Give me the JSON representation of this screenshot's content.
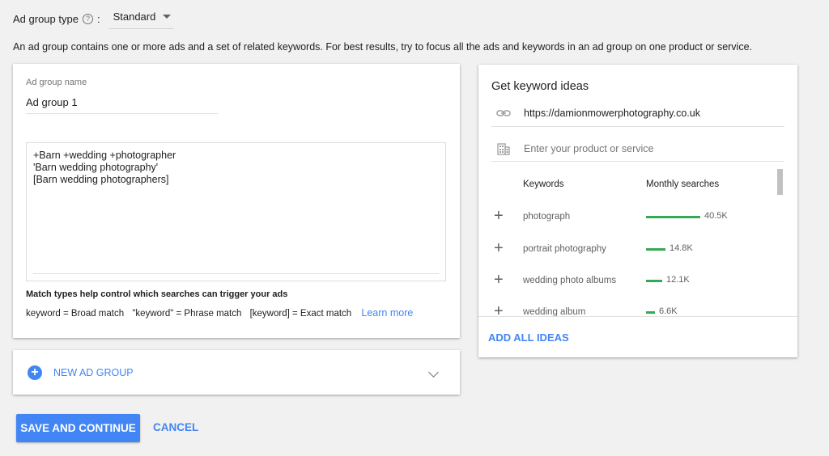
{
  "ad_group_type": {
    "label": "Ad group type",
    "help_icon": "?",
    "colon": ":",
    "selected": "Standard"
  },
  "description": "An ad group contains one or more ads and a set of related keywords. For best results, try to focus all the ads and keywords in an ad group on one product or service.",
  "ad_group": {
    "name_label": "Ad group name",
    "name_value": "Ad group 1",
    "keywords": [
      "+Barn +wedding +photographer",
      "'Barn wedding photography'",
      "[Barn wedding photographers]"
    ],
    "match_title": "Match types help control which searches can trigger your ads",
    "match_broad": "keyword = Broad match",
    "match_phrase": "\"keyword\" = Phrase match",
    "match_exact": "[keyword] = Exact match",
    "learn_more": "Learn more"
  },
  "new_ad_group": {
    "plus_glyph": "+",
    "label": "NEW AD GROUP"
  },
  "actions": {
    "save": "SAVE AND CONTINUE",
    "cancel": "CANCEL"
  },
  "keyword_ideas": {
    "title": "Get keyword ideas",
    "url": "https://damionmowerphotography.co.uk",
    "product_placeholder": "Enter your product or service",
    "col_keywords": "Keywords",
    "col_searches": "Monthly searches",
    "rows": [
      {
        "keyword": "photograph",
        "searches": "40.5K",
        "fraction": 1.0
      },
      {
        "keyword": "portrait photography",
        "searches": "14.8K",
        "fraction": 0.365
      },
      {
        "keyword": "wedding photo albums",
        "searches": "12.1K",
        "fraction": 0.299
      },
      {
        "keyword": "wedding album",
        "searches": "6.6K",
        "fraction": 0.163
      }
    ],
    "add_all": "ADD ALL IDEAS"
  },
  "colors": {
    "accent": "#4285f4",
    "bar": "#34a853",
    "background": "#f1f1f1"
  },
  "icons": {
    "help": "help-icon",
    "dropdown": "chevron-down-icon",
    "link": "link-icon",
    "product": "building-icon",
    "add": "plus-icon",
    "expand": "chevron-down-icon"
  }
}
